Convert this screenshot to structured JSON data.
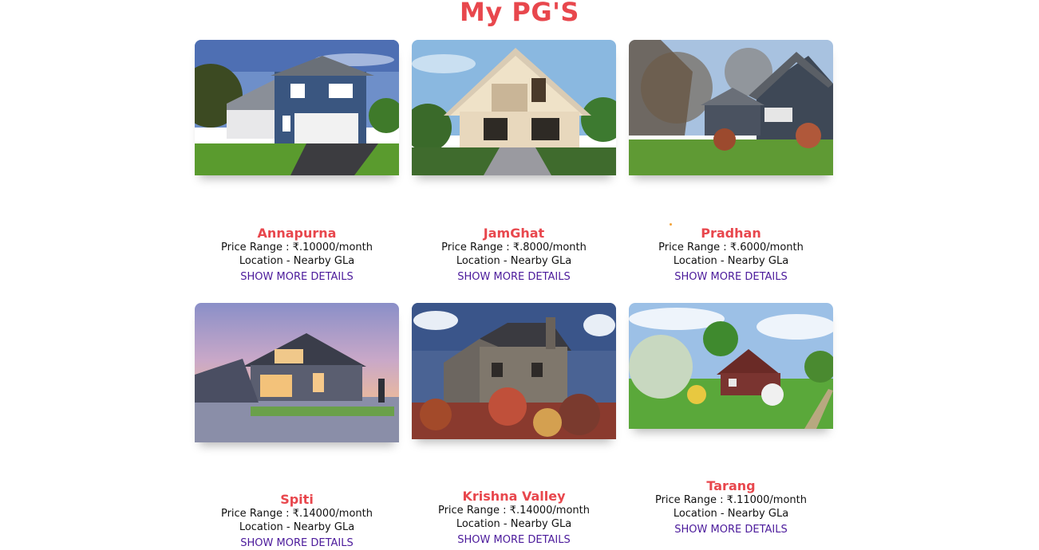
{
  "page": {
    "title": "My PG'S"
  },
  "labels": {
    "price_prefix": "Price Range : ",
    "location_prefix": "Location - ",
    "details": "SHOW MORE DETAILS"
  },
  "pgs": [
    {
      "name": "Annapurna",
      "price": "₹.10000/month",
      "location": "Nearby GLa"
    },
    {
      "name": "JamGhat",
      "price": "₹.8000/month",
      "location": "Nearby GLa"
    },
    {
      "name": "Pradhan",
      "price": "₹.6000/month",
      "location": "Nearby GLa"
    },
    {
      "name": "Spiti",
      "price": "₹.14000/month",
      "location": "Nearby GLa"
    },
    {
      "name": "Krishna Valley",
      "price": "₹.14000/month",
      "location": "Nearby GLa"
    },
    {
      "name": "Tarang",
      "price": "₹.11000/month",
      "location": "Nearby GLa"
    }
  ],
  "colors": {
    "accent": "#e8474d",
    "link": "#4b1a9b"
  }
}
